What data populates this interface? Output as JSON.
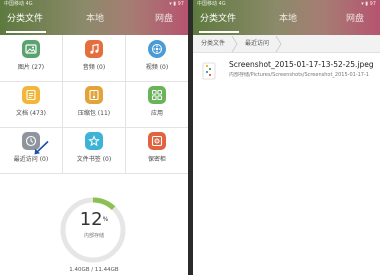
{
  "status_bar": {
    "carrier": "中国移动 4G",
    "indicators": "▾ ▮ 97"
  },
  "tabs": [
    {
      "label": "分类文件"
    },
    {
      "label": "本地"
    },
    {
      "label": "网盘"
    }
  ],
  "categories": [
    {
      "label": "图片 (27)",
      "icon": "image-icon",
      "color": "#5aa36e"
    },
    {
      "label": "音频 (0)",
      "icon": "music-icon",
      "color": "#e36f3f"
    },
    {
      "label": "视频 (0)",
      "icon": "video-icon",
      "color": "#4a9bd6"
    },
    {
      "label": "文档 (473)",
      "icon": "document-icon",
      "color": "#f1b63a"
    },
    {
      "label": "压缩包 (11)",
      "icon": "archive-icon",
      "color": "#e2a33a"
    },
    {
      "label": "应用",
      "icon": "apps-icon",
      "color": "#69b45a"
    },
    {
      "label": "最近访问 (0)",
      "icon": "clock-icon",
      "color": "#8e959c"
    },
    {
      "label": "文件书签 (0)",
      "icon": "star-icon",
      "color": "#3fb3d6"
    },
    {
      "label": "保密柜",
      "icon": "safe-icon",
      "color": "#e0643f"
    }
  ],
  "storage": {
    "percent": "12",
    "percent_sign": "%",
    "label": "内部存储",
    "used_total": "1.40GB / 11.44GB",
    "fraction_used": 0.12,
    "track_color": "#e6e6e6",
    "fill_color": "#8cc152"
  },
  "breadcrumb": [
    "分类文件",
    "最近访问"
  ],
  "recent_files": [
    {
      "name": "Screenshot_2015-01-17-13-52-25.jpeg",
      "path": "内部存储/Pictures/Screenshots/Screenshot_2015-01-17-1",
      "icon": "image-file-icon"
    }
  ],
  "accent_color": "#1f4fa8"
}
